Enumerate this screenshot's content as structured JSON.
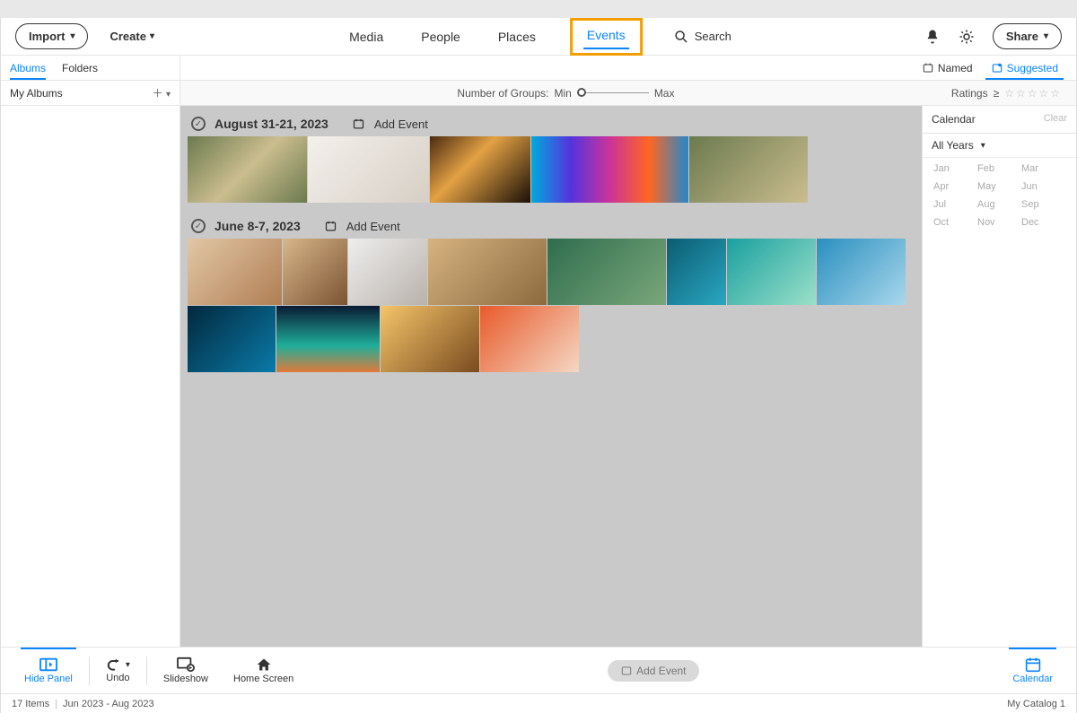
{
  "topbar": {
    "import": "Import",
    "create": "Create",
    "nav": {
      "media": "Media",
      "people": "People",
      "places": "Places",
      "events": "Events",
      "search": "Search"
    },
    "share": "Share"
  },
  "subtabs": {
    "albums": "Albums",
    "folders": "Folders",
    "named": "Named",
    "suggested": "Suggested"
  },
  "sidebar": {
    "my_albums": "My Albums"
  },
  "filters": {
    "groups_label": "Number of Groups:",
    "min": "Min",
    "max": "Max",
    "ratings": "Ratings",
    "gte": "≥"
  },
  "events": [
    {
      "date": "August 31-21, 2023",
      "add": "Add Event",
      "thumbs": [
        {
          "w": 133,
          "c": "t1"
        },
        {
          "w": 135,
          "c": "t2"
        },
        {
          "w": 112,
          "c": "t3"
        },
        {
          "w": 175,
          "c": "t4"
        },
        {
          "w": 132,
          "c": "t5"
        }
      ]
    },
    {
      "date": "June 8-7, 2023",
      "add": "Add Event",
      "thumbs": [
        {
          "w": 105,
          "c": "tb1"
        },
        {
          "w": 72,
          "c": "tb2"
        },
        {
          "w": 88,
          "c": "tb3"
        },
        {
          "w": 132,
          "c": "tb4"
        },
        {
          "w": 132,
          "c": "tb5"
        },
        {
          "w": 66,
          "c": "tb6"
        },
        {
          "w": 99,
          "c": "tb7"
        },
        {
          "w": 99,
          "c": "tb8"
        },
        {
          "w": 98,
          "c": "tb9"
        },
        {
          "w": 115,
          "c": "tb10"
        },
        {
          "w": 110,
          "c": "tb11"
        },
        {
          "w": 110,
          "c": "tb12"
        }
      ]
    }
  ],
  "calendar": {
    "title": "Calendar",
    "clear": "Clear",
    "years": "All Years",
    "months": [
      "Jan",
      "Feb",
      "Mar",
      "Apr",
      "May",
      "Jun",
      "Jul",
      "Aug",
      "Sep",
      "Oct",
      "Nov",
      "Dec"
    ]
  },
  "bottom": {
    "hide_panel": "Hide Panel",
    "undo": "Undo",
    "slideshow": "Slideshow",
    "home": "Home Screen",
    "add_event": "Add Event",
    "calendar": "Calendar"
  },
  "status": {
    "items": "17 Items",
    "range": "Jun 2023 - Aug 2023",
    "catalog": "My Catalog 1"
  }
}
